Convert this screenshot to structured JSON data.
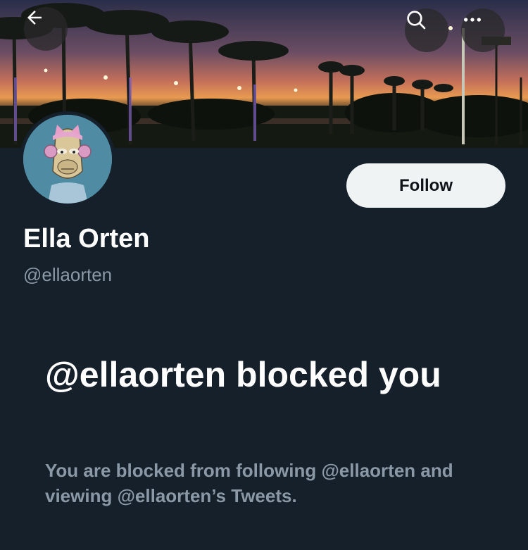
{
  "header": {
    "back_icon": "arrow-left-icon",
    "search_icon": "search-icon",
    "more_icon": "more-horizontal-icon"
  },
  "profile": {
    "display_name": "Ella Orten",
    "handle": "@ellaorten",
    "follow_label": "Follow"
  },
  "blocked": {
    "title": "@ellaorten blocked you",
    "description": "You are blocked from following @ellaorten and viewing @ellaorten’s Tweets."
  },
  "colors": {
    "background": "#15202b",
    "secondary_text": "#8b98a5",
    "follow_button": "#eff3f4"
  }
}
